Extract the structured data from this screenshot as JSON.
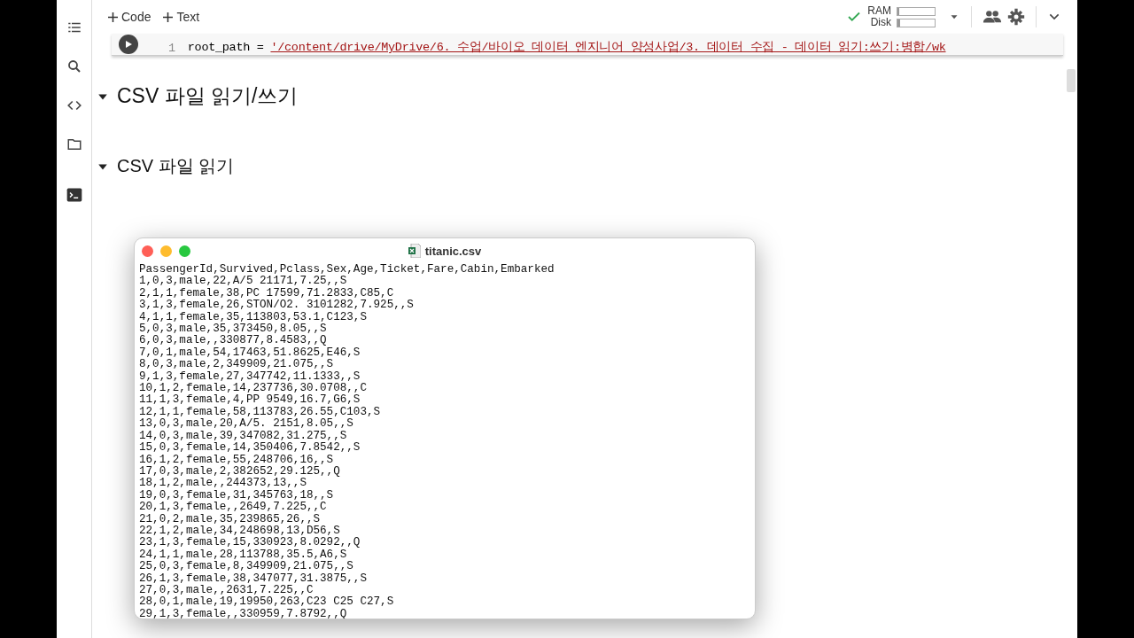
{
  "toolbar": {
    "buttons": [
      {
        "label": "Code"
      },
      {
        "label": "Text"
      }
    ],
    "resources": [
      {
        "label": "RAM",
        "level": 0.05
      },
      {
        "label": "Disk",
        "level": 0.08
      }
    ]
  },
  "code_cell": {
    "line_number": "1",
    "code": "root_path = ",
    "string": "'/content/drive/MyDrive/6. 수업/바이오 데이터 엔지니어 양성사업/3. 데이터 수집 - 데이터 읽기:쓰기:병합/wk"
  },
  "headings": [
    {
      "text": "CSV 파일 읽기/쓰기",
      "expanded": true,
      "kind": "h1"
    },
    {
      "text": "CSV 파일 읽기",
      "expanded": true,
      "kind": "h2"
    }
  ],
  "csv_window": {
    "title": "titanic.csv",
    "lines": [
      "PassengerId,Survived,Pclass,Sex,Age,Ticket,Fare,Cabin,Embarked",
      "1,0,3,male,22,A/5 21171,7.25,,S",
      "2,1,1,female,38,PC 17599,71.2833,C85,C",
      "3,1,3,female,26,STON/O2. 3101282,7.925,,S",
      "4,1,1,female,35,113803,53.1,C123,S",
      "5,0,3,male,35,373450,8.05,,S",
      "6,0,3,male,,330877,8.4583,,Q",
      "7,0,1,male,54,17463,51.8625,E46,S",
      "8,0,3,male,2,349909,21.075,,S",
      "9,1,3,female,27,347742,11.1333,,S",
      "10,1,2,female,14,237736,30.0708,,C",
      "11,1,3,female,4,PP 9549,16.7,G6,S",
      "12,1,1,female,58,113783,26.55,C103,S",
      "13,0,3,male,20,A/5. 2151,8.05,,S",
      "14,0,3,male,39,347082,31.275,,S",
      "15,0,3,female,14,350406,7.8542,,S",
      "16,1,2,female,55,248706,16,,S",
      "17,0,3,male,2,382652,29.125,,Q",
      "18,1,2,male,,244373,13,,S",
      "19,0,3,female,31,345763,18,,S",
      "20,1,3,female,,2649,7.225,,C",
      "21,0,2,male,35,239865,26,,S",
      "22,1,2,male,34,248698,13,D56,S",
      "23,1,3,female,15,330923,8.0292,,Q",
      "24,1,1,male,28,113788,35.5,A6,S",
      "25,0,3,female,8,349909,21.075,,S",
      "26,1,3,female,38,347077,31.3875,,S",
      "27,0,3,male,,2631,7.225,,C",
      "28,0,1,male,19,19950,263,C23 C25 C27,S",
      "29,1,3,female,,330959,7.8792,,Q"
    ]
  }
}
